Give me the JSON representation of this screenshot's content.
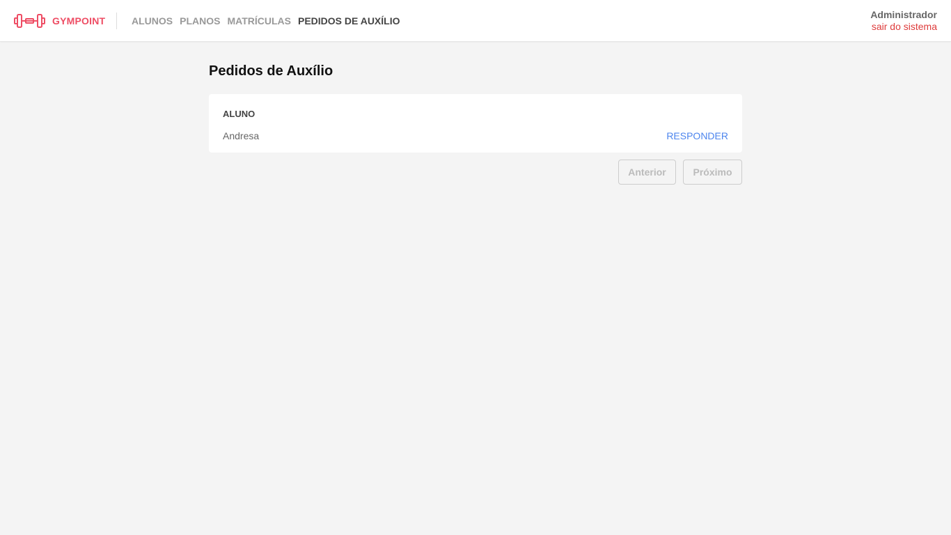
{
  "header": {
    "brand": "GYMPOINT",
    "nav": [
      "ALUNOS",
      "PLANOS",
      "MATRÍCULAS",
      "PEDIDOS DE AUXÍLIO"
    ],
    "active_nav": "PEDIDOS DE AUXÍLIO",
    "user_name": "Administrador",
    "logout_label": "sair do sistema",
    "brand_color": "#ee4d64"
  },
  "main": {
    "title": "Pedidos de Auxílio",
    "table": {
      "column": "ALUNO",
      "rows": [
        {
          "name": "Andresa",
          "action": "RESPONDER"
        }
      ]
    },
    "pagination": {
      "prev_label": "Anterior",
      "next_label": "Próximo"
    }
  }
}
